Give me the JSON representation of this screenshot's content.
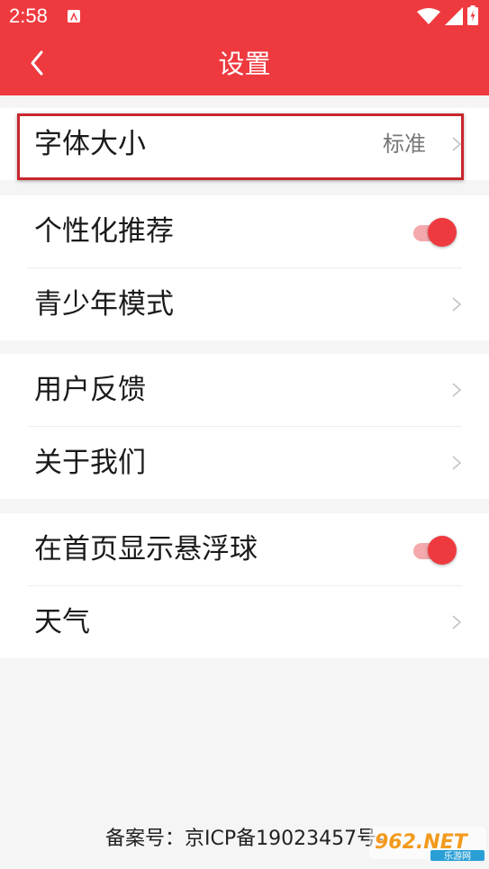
{
  "status_bar": {
    "time": "2:58",
    "icons": [
      "app-notification-icon",
      "wifi-icon",
      "signal-icon",
      "battery-icon"
    ]
  },
  "header": {
    "title": "设置",
    "back_icon": "chevron-left-icon"
  },
  "settings": {
    "font_size": {
      "label": "字体大小",
      "value": "标准"
    },
    "personalized_recommend": {
      "label": "个性化推荐",
      "enabled": true
    },
    "teen_mode": {
      "label": "青少年模式"
    },
    "feedback": {
      "label": "用户反馈"
    },
    "about_us": {
      "label": "关于我们"
    },
    "floating_ball": {
      "label": "在首页显示悬浮球",
      "enabled": true
    },
    "weather": {
      "label": "天气"
    }
  },
  "footer": {
    "icp": "备案号：京ICP备19023457号-"
  },
  "watermark": {
    "text": "962.NET",
    "subtext": "乐游网"
  },
  "colors": {
    "accent": "#ee3a3f",
    "toggle_track": "#f4a9ac",
    "background": "#f5f5f5"
  }
}
